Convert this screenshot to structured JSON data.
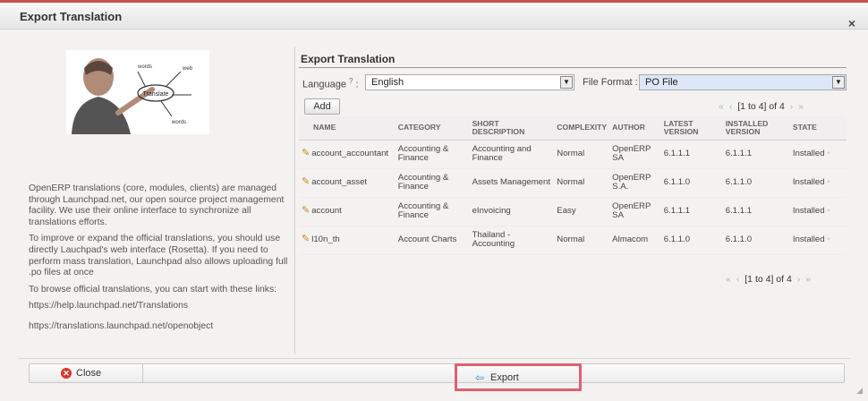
{
  "dialog": {
    "title": "Export Translation",
    "close_glyph": "×"
  },
  "left": {
    "diagram_words": [
      "Translate",
      "words",
      "web",
      "words"
    ],
    "paragraphs": [
      "OpenERP translations (core, modules, clients) are managed through Launchpad.net, our open source project management facility. We use their online interface to synchronize all translations efforts.",
      "To improve or expand the official translations, you should use directly Lauchpad's web interface (Rosetta). If you need to perform mass translation, Launchpad also allows uploading full .po files at once",
      "To browse official translations, you can start with these links:"
    ],
    "links": [
      "https://help.launchpad.net/Translations",
      "https://translations.launchpad.net/openobject"
    ]
  },
  "form": {
    "section_title": "Export Translation",
    "language_label": "Language",
    "required_mark": "?",
    "language_value": "English",
    "file_format_label": "File Format :",
    "file_format_value": "PO File"
  },
  "table": {
    "add_label": "Add",
    "pager_text": "[1 to 4] of 4",
    "columns": [
      "NAME",
      "CATEGORY",
      "SHORT DESCRIPTION",
      "COMPLEXITY",
      "AUTHOR",
      "LATEST VERSION",
      "INSTALLED VERSION",
      "STATE"
    ],
    "rows": [
      [
        "account_accountant",
        "Accounting & Finance",
        "Accounting and Finance",
        "Normal",
        "OpenERP SA",
        "6.1.1.1",
        "6.1.1.1",
        "Installed"
      ],
      [
        "account_asset",
        "Accounting & Finance",
        "Assets Management",
        "Normal",
        "OpenERP S.A.",
        "6.1.1.0",
        "6.1.1.0",
        "Installed"
      ],
      [
        "account",
        "Accounting & Finance",
        "eInvoicing",
        "Easy",
        "OpenERP SA",
        "6.1.1.1",
        "6.1.1.1",
        "Installed"
      ],
      [
        "l10n_th",
        "Account Charts",
        "Thailand - Accounting",
        "Normal",
        "Almacom",
        "6.1.1.0",
        "6.1.1.0",
        "Installed"
      ]
    ]
  },
  "footer": {
    "close_label": "Close",
    "export_label": "Export"
  },
  "colors": {
    "accent_red": "#c9504f",
    "highlight_border": "#e0606f",
    "file_format_bg": "#dce7f7"
  }
}
